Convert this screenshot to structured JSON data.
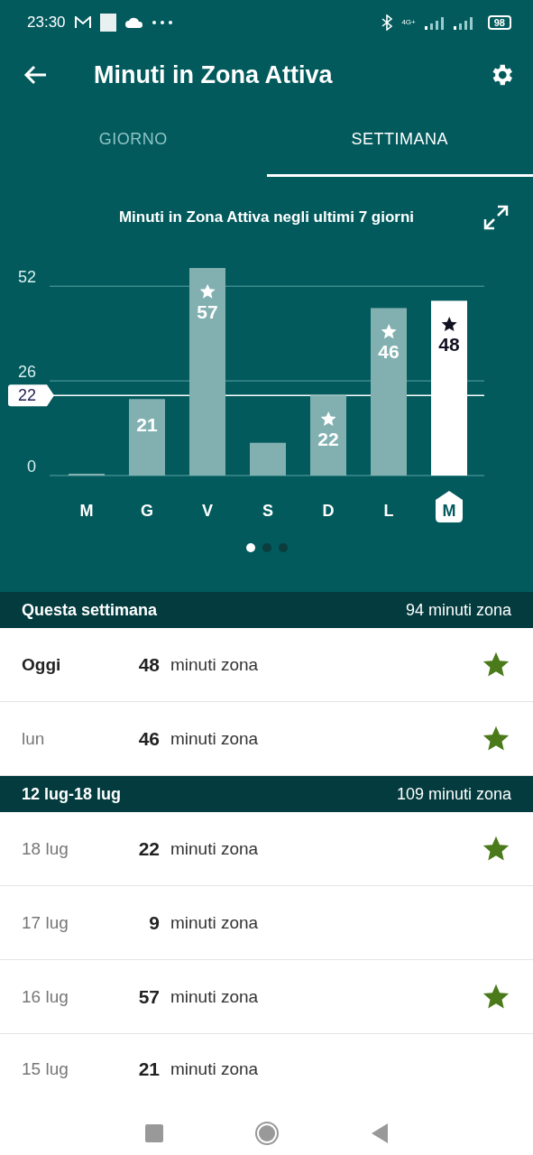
{
  "status_bar": {
    "time": "23:30",
    "network": "4G+",
    "battery": "98"
  },
  "header": {
    "title": "Minuti in Zona Attiva"
  },
  "tabs": [
    {
      "label": "GIORNO",
      "selected": false
    },
    {
      "label": "SETTIMANA",
      "selected": true
    }
  ],
  "chart": {
    "chart_data": {
      "type": "bar",
      "title": "Minuti in Zona Attiva negli ultimi 7 giorni",
      "categories": [
        "M",
        "G",
        "V",
        "S",
        "D",
        "L",
        "M"
      ],
      "values": [
        0,
        21,
        57,
        9,
        22,
        46,
        48
      ],
      "ylim": [
        0,
        57
      ],
      "yticks": [
        0,
        26,
        52
      ],
      "value_labels": [
        null,
        "21",
        "57",
        null,
        "22",
        "46",
        "48"
      ],
      "ref_lines": [
        {
          "axis": "y",
          "value": 22,
          "label": "22"
        }
      ]
    },
    "bars": [
      {
        "starred": false,
        "selected": false
      },
      {
        "starred": false,
        "selected": false
      },
      {
        "starred": true,
        "selected": false
      },
      {
        "starred": false,
        "selected": false
      },
      {
        "starred": true,
        "selected": false
      },
      {
        "starred": true,
        "selected": false
      },
      {
        "starred": true,
        "selected": true
      }
    ]
  },
  "pager": [
    {
      "selected": true
    },
    {
      "selected": false
    },
    {
      "selected": false
    }
  ],
  "sections": [
    {
      "title": "Questa settimana",
      "total": "94 minuti zona",
      "rows": [
        {
          "day": "Oggi",
          "today": true,
          "minutes": "48",
          "unit": "minuti zona",
          "starred": true
        },
        {
          "day": "lun",
          "today": false,
          "minutes": "46",
          "unit": "minuti zona",
          "starred": true
        }
      ]
    },
    {
      "title": "12 lug-18 lug",
      "total": "109 minuti zona",
      "rows": [
        {
          "day": "18 lug",
          "today": false,
          "minutes": "22",
          "unit": "minuti zona",
          "starred": true
        },
        {
          "day": "17 lug",
          "today": false,
          "minutes": "9",
          "unit": "minuti zona",
          "starred": false
        },
        {
          "day": "16 lug",
          "today": false,
          "minutes": "57",
          "unit": "minuti zona",
          "starred": true
        },
        {
          "day": "15 lug",
          "today": false,
          "minutes": "21",
          "unit": "minuti zona",
          "starred": false
        }
      ]
    }
  ]
}
